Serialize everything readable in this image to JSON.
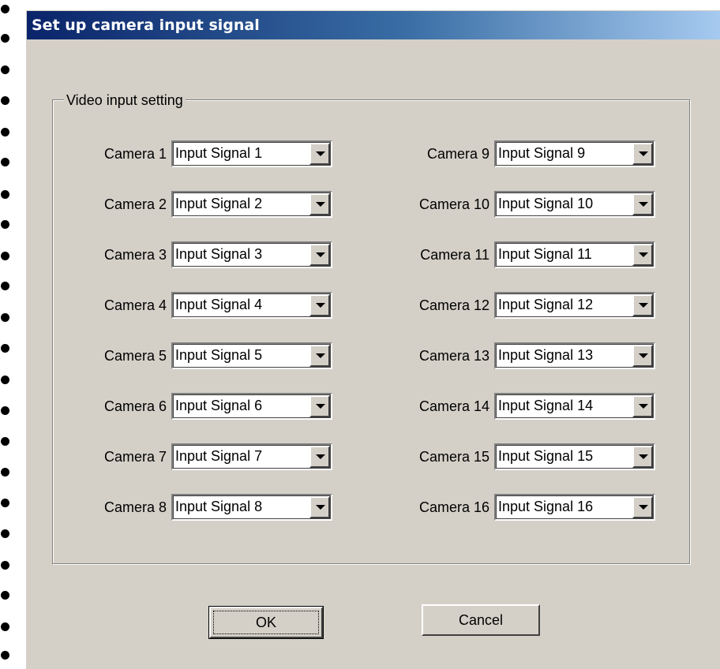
{
  "window": {
    "title": "Set up camera input signal"
  },
  "group": {
    "label": "Video input setting"
  },
  "cameras": [
    {
      "label": "Camera 1",
      "value": "Input Signal 1"
    },
    {
      "label": "Camera 2",
      "value": "Input Signal 2"
    },
    {
      "label": "Camera 3",
      "value": "Input Signal 3"
    },
    {
      "label": "Camera 4",
      "value": "Input Signal 4"
    },
    {
      "label": "Camera 5",
      "value": "Input Signal 5"
    },
    {
      "label": "Camera 6",
      "value": "Input Signal 6"
    },
    {
      "label": "Camera 7",
      "value": "Input Signal 7"
    },
    {
      "label": "Camera 8",
      "value": "Input Signal 8"
    },
    {
      "label": "Camera 9",
      "value": "Input Signal 9"
    },
    {
      "label": "Camera 10",
      "value": "Input Signal 10"
    },
    {
      "label": "Camera 11",
      "value": "Input Signal 11"
    },
    {
      "label": "Camera 12",
      "value": "Input Signal 12"
    },
    {
      "label": "Camera 13",
      "value": "Input Signal 13"
    },
    {
      "label": "Camera 14",
      "value": "Input Signal 14"
    },
    {
      "label": "Camera 15",
      "value": "Input Signal 15"
    },
    {
      "label": "Camera 16",
      "value": "Input Signal 16"
    }
  ],
  "buttons": {
    "ok": "OK",
    "cancel": "Cancel"
  },
  "icons": {
    "dropdown": "chevron-down-icon",
    "bullet": "bullet-icon"
  },
  "colors": {
    "dialog_face": "#d4d0c8",
    "titlebar_start": "#0a246a",
    "titlebar_end": "#a6caf0",
    "title_text": "#ffffff"
  }
}
